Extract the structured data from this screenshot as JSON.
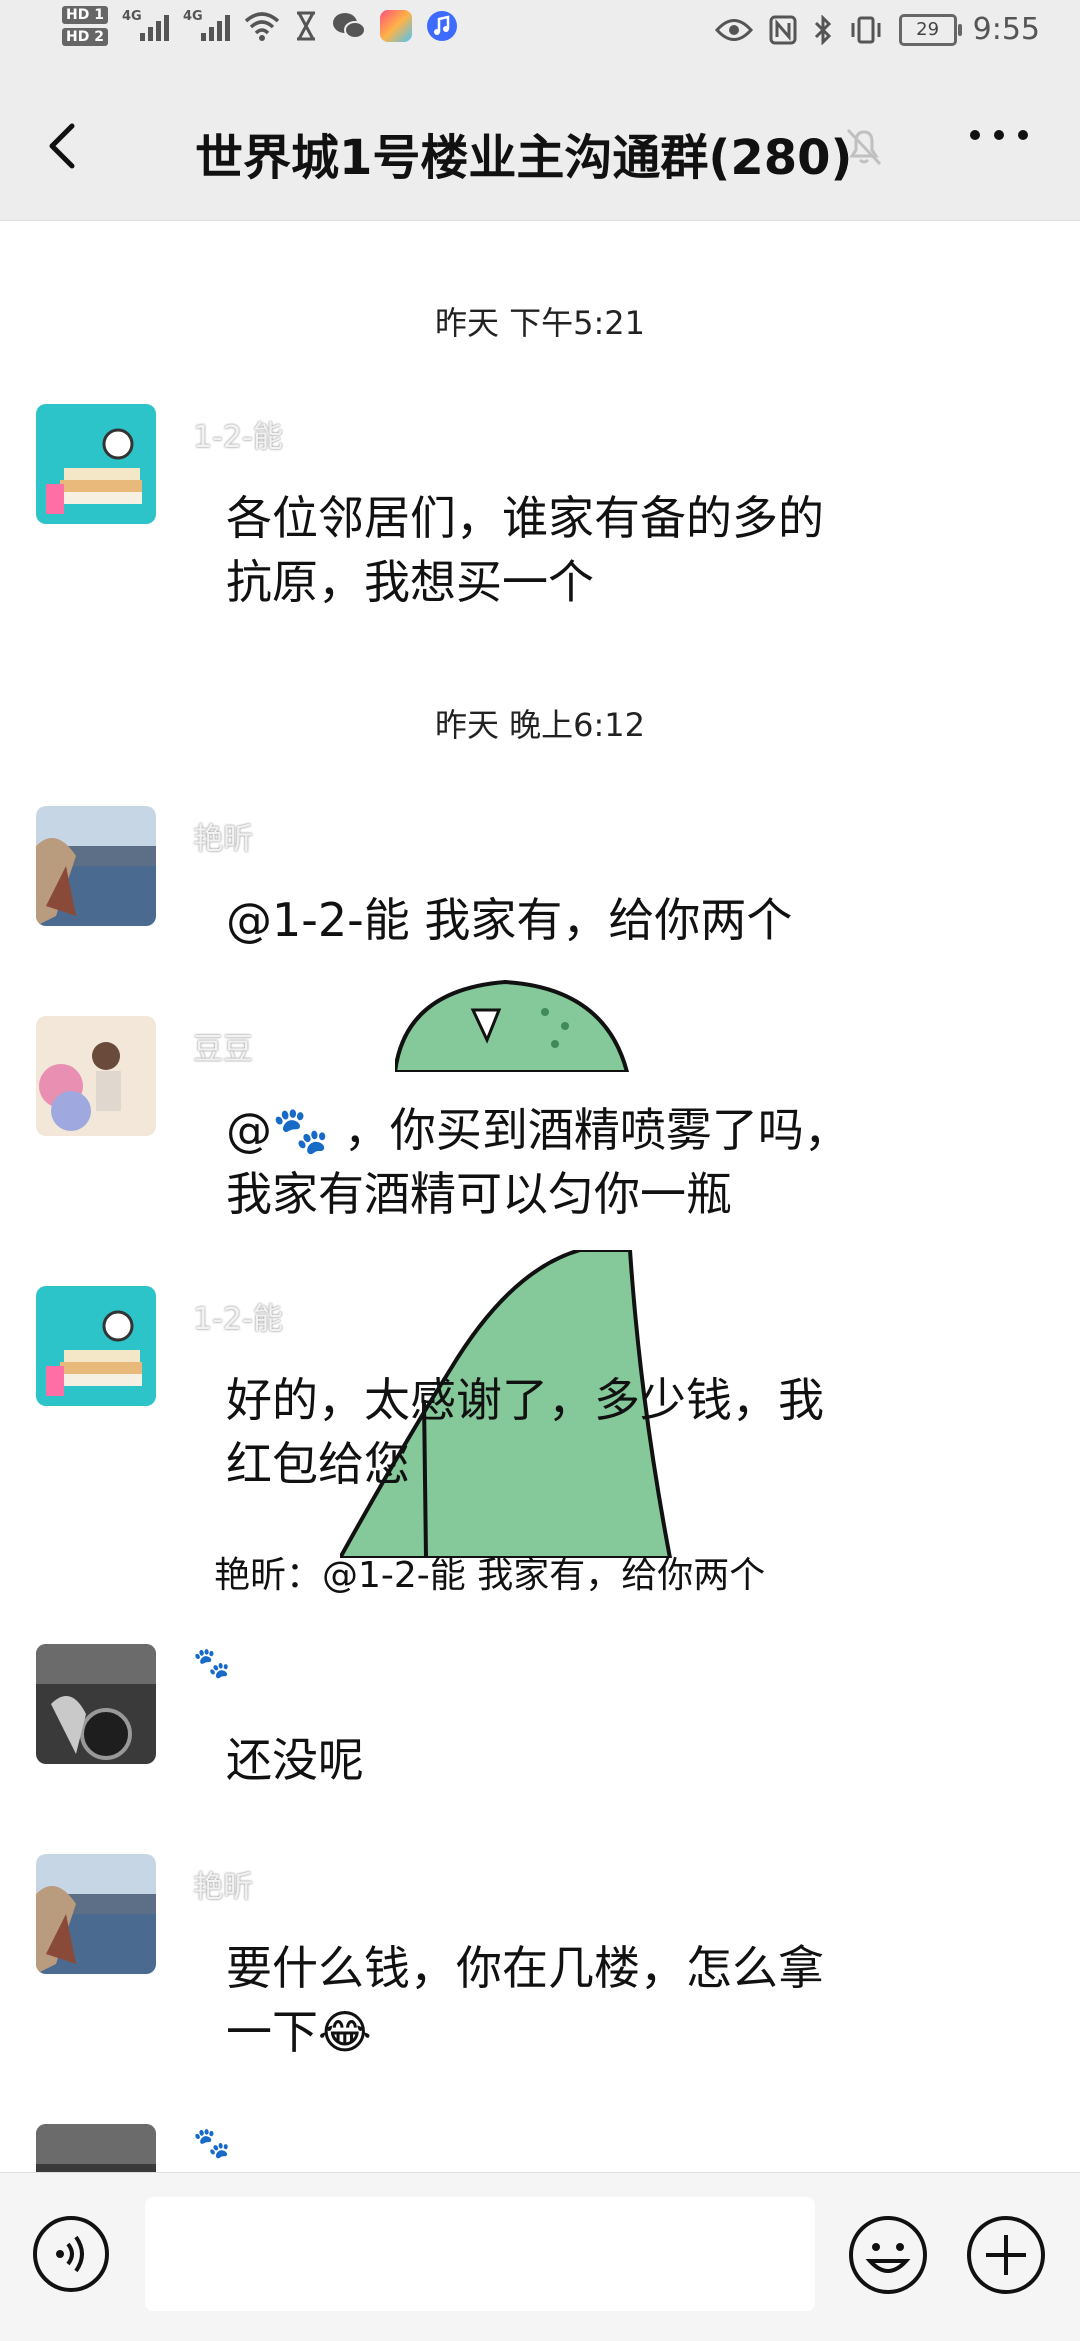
{
  "status_bar": {
    "sim1": "HD 1",
    "sim2": "HD 2",
    "net1": "4G",
    "net2": "4G",
    "battery": "29",
    "time": "9:55",
    "icons": [
      "signal-icon",
      "wifi-icon",
      "hourglass-icon",
      "wechat-icon",
      "app-icon",
      "music-icon",
      "eye-icon",
      "nfc-icon",
      "bluetooth-icon",
      "vibrate-icon",
      "battery-icon"
    ]
  },
  "header": {
    "title": "世界城1号楼业主沟通群(280)",
    "back_icon": "back-arrow-icon",
    "mute_icon": "bell-muted-icon",
    "more_icon": "more-icon"
  },
  "timestamps": {
    "t1": "昨天 下午5:21",
    "t2": "昨天 晚上6:12"
  },
  "messages": [
    {
      "sender": "1-2-能",
      "lines": [
        "各位邻居们，谁家有备的多的",
        "抗原，我想买一个"
      ]
    },
    {
      "sender": "艳昕",
      "lines": [
        "@1-2-能  我家有，给你两个"
      ]
    },
    {
      "sender": "豆豆",
      "lines": [
        "@🐾 ，你买到酒精喷雾了吗，",
        "我家有酒精可以匀你一瓶"
      ]
    },
    {
      "sender": "1-2-能",
      "lines": [
        "好的，太感谢了，多少钱，我",
        "红包给您"
      ]
    },
    {
      "quote": "艳昕：@1-2-能 我家有，给你两个"
    },
    {
      "sender": "🐾",
      "lines": [
        "还没呢"
      ]
    },
    {
      "sender": "艳昕",
      "lines": [
        "要什么钱，你在几楼，怎么拿",
        "一下😂"
      ]
    },
    {
      "sender": "🐾",
      "lines": []
    }
  ],
  "bottom_bar": {
    "voice_icon": "voice-icon",
    "input_value": "",
    "emoji_icon": "emoji-icon",
    "plus_icon": "plus-icon"
  }
}
